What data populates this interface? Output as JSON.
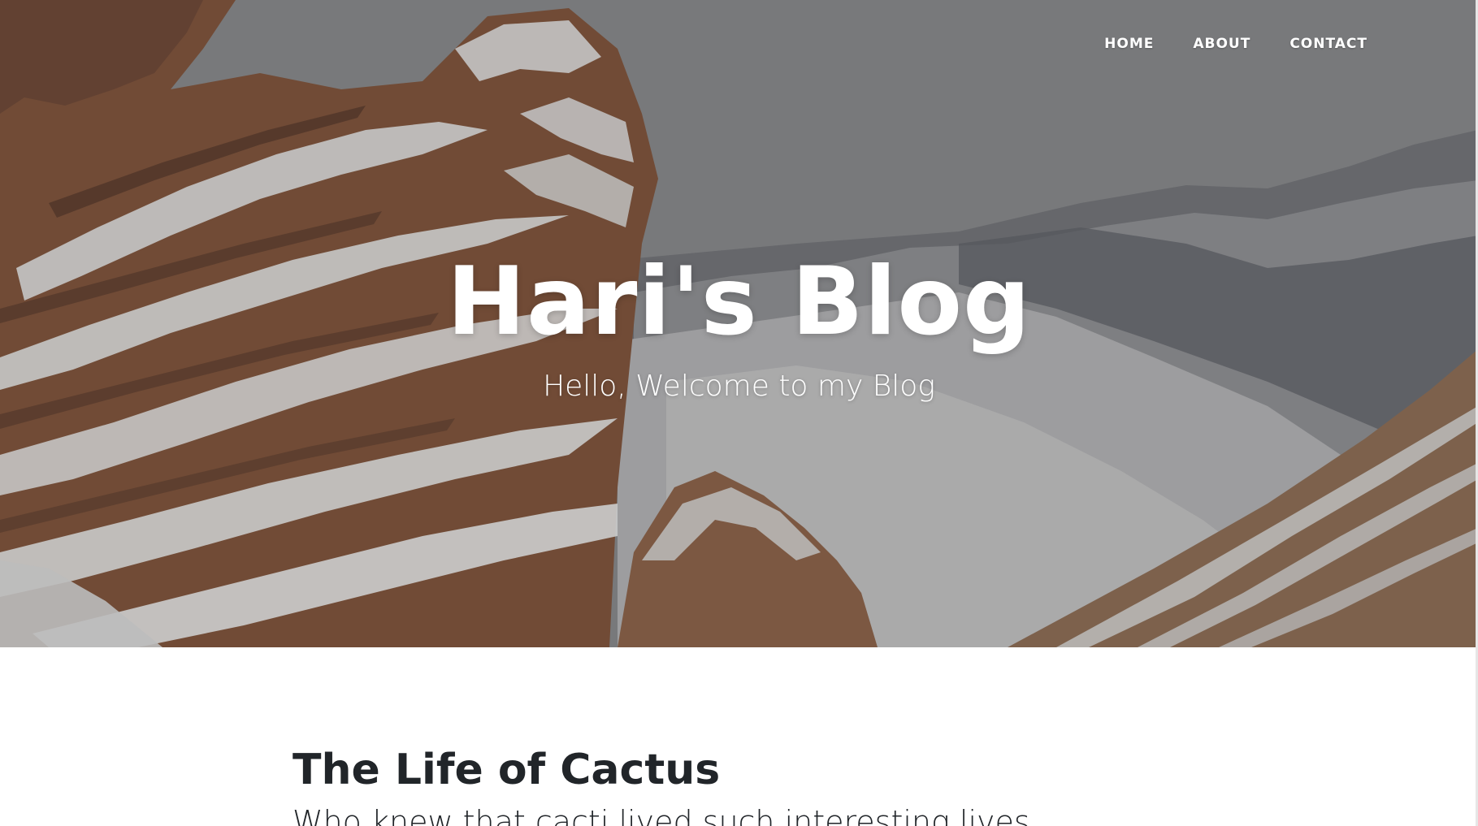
{
  "nav": {
    "items": [
      {
        "label": "HOME"
      },
      {
        "label": "ABOUT"
      },
      {
        "label": "CONTACT"
      }
    ]
  },
  "hero": {
    "title": "Hari's Blog",
    "subtitle": "Hello, Welcome to my Blog",
    "background_image": "snowy-red-rock-mountains"
  },
  "posts": [
    {
      "title": "The Life of Cactus",
      "subtitle": "Who knew that cacti lived such interesting lives."
    }
  ],
  "colors": {
    "hero_tint": "#7f8084",
    "nav_text": "#ffffff",
    "heading_text": "#212529",
    "page_bg": "#ffffff"
  }
}
